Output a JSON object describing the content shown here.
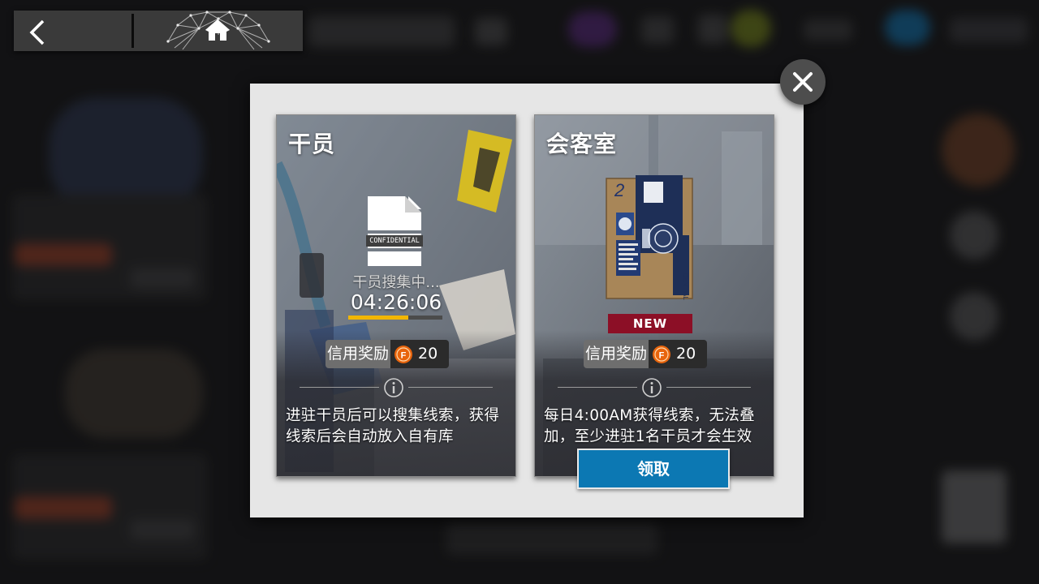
{
  "header": {
    "back_icon": "chevron-left-icon",
    "home_icon": "home-icon"
  },
  "dialog": {
    "close_icon": "close-icon",
    "cards": [
      {
        "title": "干员",
        "doc_stamp": "CONFIDENTIAL",
        "status": "干员搜集中...",
        "timer": "04:26:06",
        "progress": 0.64,
        "reward_label": "信用奖励",
        "reward_value": "20",
        "description": "进驻干员后可以搜集线索，获得线索后会自动放入自有库"
      },
      {
        "title": "会客室",
        "badge": "NEW",
        "reward_label": "信用奖励",
        "reward_value": "20",
        "description": "每日4:00AM获得线索，无法叠加，至少进驻1名干员才会生效",
        "claim_label": "领取"
      }
    ]
  },
  "colors": {
    "progress": "#f2b600",
    "badge": "#8c0f26",
    "claim_button": "#0c78b3",
    "credit_coin": "#e8640c"
  }
}
